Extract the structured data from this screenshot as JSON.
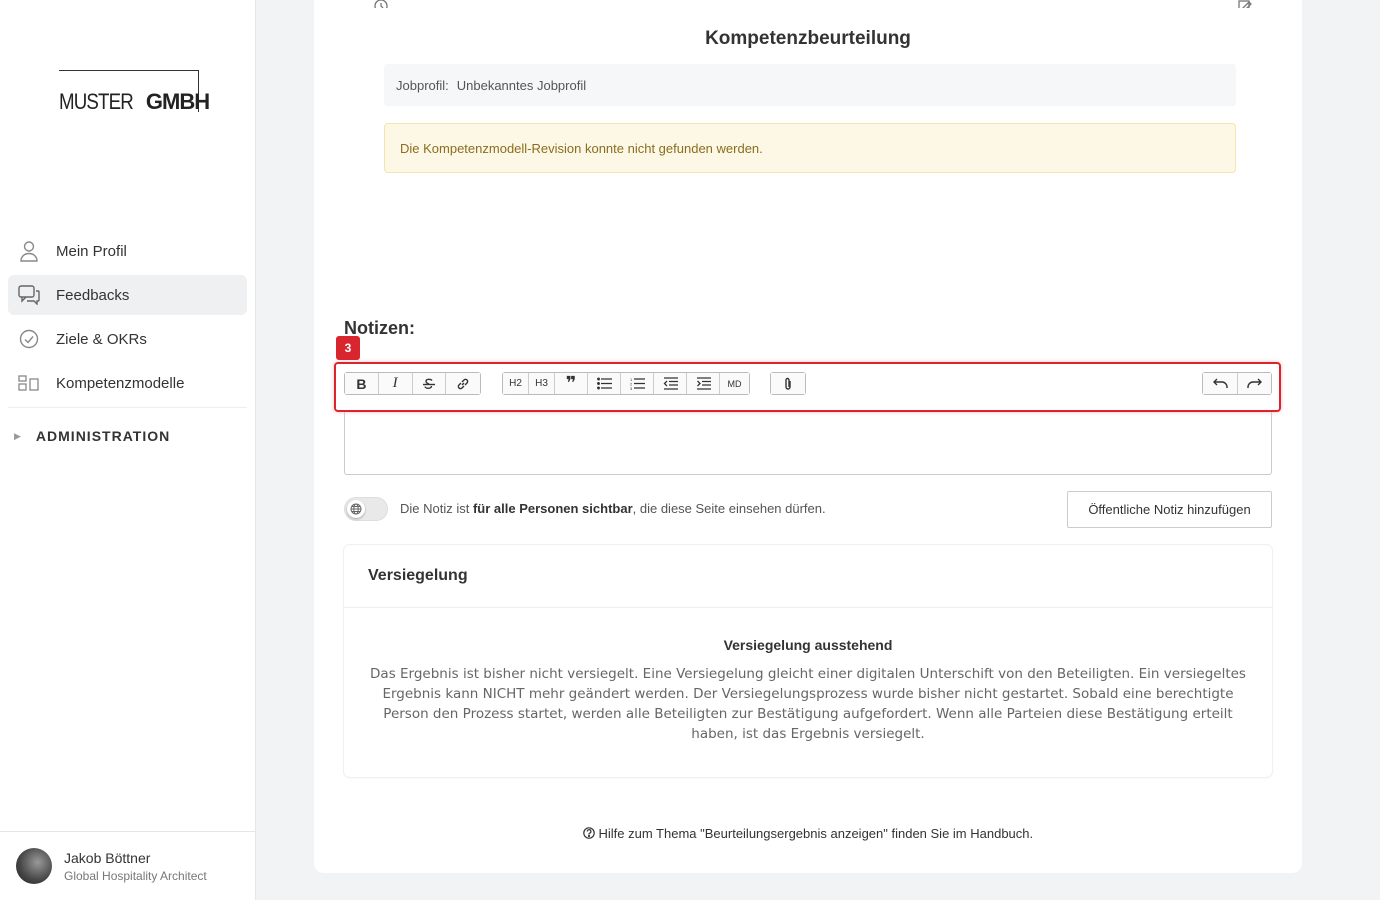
{
  "brand": {
    "logo_thin": "MUSTER",
    "logo_bold": "GMBH"
  },
  "sidebar": {
    "items": [
      {
        "label": "Mein Profil",
        "icon": "user-icon"
      },
      {
        "label": "Feedbacks",
        "icon": "chat-icon"
      },
      {
        "label": "Ziele & OKRs",
        "icon": "check-circle-icon"
      },
      {
        "label": "Kompetenzmodelle",
        "icon": "model-icon"
      }
    ],
    "active": "Feedbacks",
    "admin_label": "ADMINISTRATION"
  },
  "user": {
    "name": "Jakob Böttner",
    "role": "Global Hospitality Architect"
  },
  "main": {
    "heading": "Kompetenzbeurteilung",
    "jobprofil_label": "Jobprofil:",
    "jobprofil_value": "Unbekanntes Jobprofil",
    "warning": "Die Kompetenzmodell-Revision konnte nicht gefunden werden.",
    "notes_title": "Notizen:",
    "badge": "3",
    "toolbar": {
      "h2": "H2",
      "h3": "H3",
      "md": "MD"
    },
    "toggle_text_pre": "Die Notiz ist ",
    "toggle_text_bold": "für alle Personen sichtbar",
    "toggle_text_post": ", die diese Seite einsehen dürfen.",
    "public_button": "Öffentliche Notiz hinzufügen",
    "seal": {
      "title": "Versiegelung",
      "subtitle": "Versiegelung ausstehend",
      "text": "Das Ergebnis ist bisher nicht versiegelt. Eine Versiegelung gleicht einer digitalen Unterschift von den Beteiligten. Ein versiegeltes Ergebnis kann NICHT mehr geändert werden. Der Versiegelungsprozess wurde bisher nicht gestartet. Sobald eine berechtigte Person den Prozess startet, werden alle Beteiligten zur Bestätigung aufgefordert. Wenn alle Parteien diese Bestätigung erteilt haben, ist das Ergebnis versiegelt."
    },
    "help_text": "Hilfe zum Thema \"Beurteilungsergebnis anzeigen\" finden Sie im Handbuch."
  }
}
